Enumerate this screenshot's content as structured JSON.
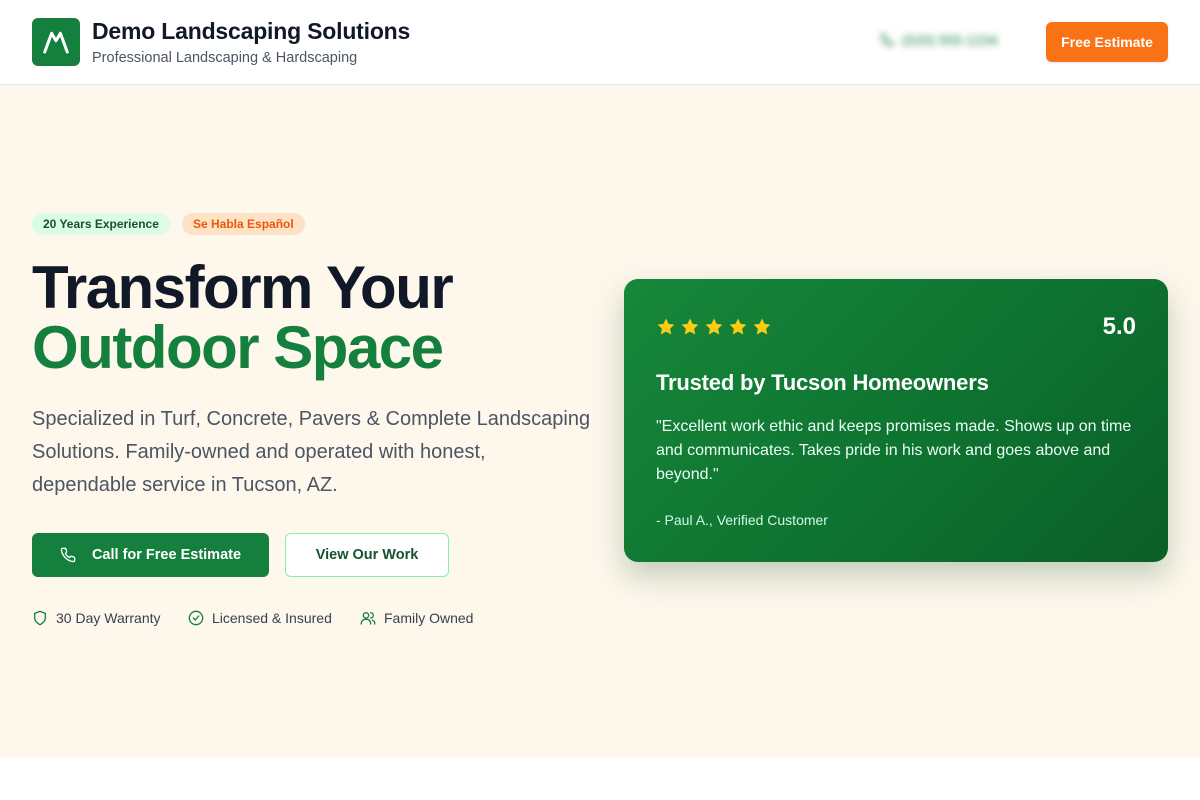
{
  "header": {
    "brand_title": "Demo Landscaping Solutions",
    "brand_subtitle": "Professional Landscaping & Hardscaping",
    "phone_text": "(520) 555-1234",
    "cta_label": "Free Estimate",
    "logo_icon": "mountain-icon"
  },
  "hero": {
    "badges": [
      "20 Years Experience",
      "Se Habla Español"
    ],
    "headline_line1": "Transform Your",
    "headline_line2": "Outdoor Space",
    "description": "Specialized in Turf, Concrete, Pavers & Complete Landscaping Solutions. Family-owned and operated with honest, dependable service in Tucson, AZ.",
    "primary_button": "Call for Free Estimate",
    "secondary_button": "View Our Work",
    "features": [
      {
        "label": "30 Day Warranty",
        "icon": "shield-icon"
      },
      {
        "label": "Licensed & Insured",
        "icon": "check-circle-icon"
      },
      {
        "label": "Family Owned",
        "icon": "users-icon"
      }
    ]
  },
  "testimonial": {
    "stars": 5,
    "rating": "5.0",
    "title": "Trusted by Tucson Homeowners",
    "quote": "\"Excellent work ethic and keeps promises made. Shows up on time and communicates. Takes pride in his work and goes above and beyond.\"",
    "author": "- Paul A., Verified Customer"
  },
  "colors": {
    "brand_green": "#15803d",
    "accent_orange": "#f97316",
    "hero_bg": "#fef7ec",
    "star_yellow": "#facc15"
  }
}
